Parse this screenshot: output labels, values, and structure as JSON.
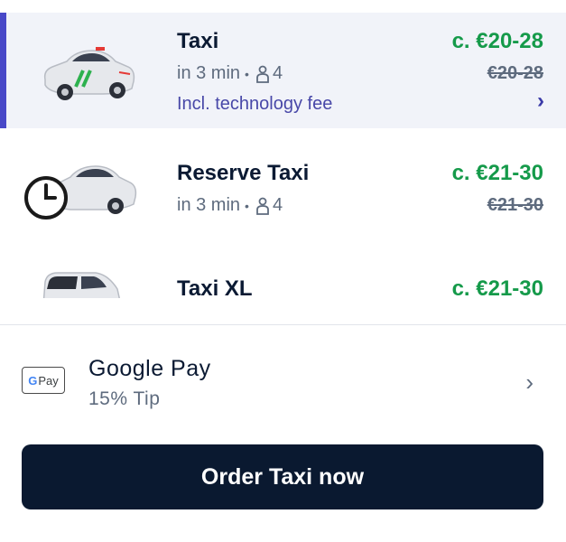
{
  "options": [
    {
      "title": "Taxi",
      "eta": "in 3 min",
      "separator": "•",
      "seats": "4",
      "note": "Incl. technology fee",
      "price": "c. €20-28",
      "old_price": "€20-28",
      "chevron": "›",
      "icon": "taxi-car-icon",
      "selected": true
    },
    {
      "title": "Reserve Taxi",
      "eta": "in 3 min",
      "separator": "•",
      "seats": "4",
      "price": "c. €21-30",
      "old_price": "€21-30",
      "icon": "clock-car-icon"
    },
    {
      "title": "Taxi XL",
      "price": "c. €21-30",
      "icon": "xl-car-icon"
    }
  ],
  "payment": {
    "badge_g": "G",
    "badge_text": "Pay",
    "method": "Google Pay",
    "tip": "15% Tip",
    "chevron": "›"
  },
  "order_button": "Order Taxi now",
  "colors": {
    "accent": "#4848c8",
    "price_green": "#159a4a",
    "button_bg": "#0a1930",
    "selected_bg": "#f1f3f9"
  }
}
